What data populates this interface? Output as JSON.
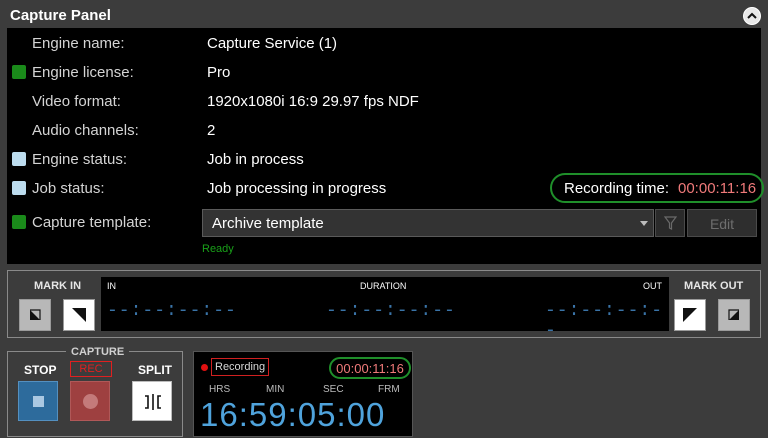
{
  "panel": {
    "title": "Capture Panel",
    "collapse_icon": "chevron-up-icon"
  },
  "info": {
    "engine_name": {
      "label": "Engine name:",
      "value": "Capture Service (1)"
    },
    "engine_license": {
      "label": "Engine license:",
      "value": "Pro",
      "status_color": "#1a8a1a"
    },
    "video_format": {
      "label": "Video format:",
      "value": "1920x1080i 16:9 29.97 fps NDF"
    },
    "audio_channels": {
      "label": "Audio channels:",
      "value": "2"
    },
    "engine_status": {
      "label": "Engine status:",
      "value": "Job in process",
      "status_color": "#bcdcee"
    },
    "job_status": {
      "label": "Job status:",
      "value": "Job processing in progress",
      "status_color": "#bcdcee"
    },
    "recording_time": {
      "label": "Recording time:",
      "value": "00:00:11:16"
    },
    "capture_template": {
      "label": "Capture template:",
      "value": "Archive template",
      "status_color": "#1a8a1a"
    },
    "filter_icon": "filter-icon",
    "edit_label": "Edit",
    "status_text": "Ready"
  },
  "timecode": {
    "mark_in_label": "MARK IN",
    "mark_out_label": "MARK OUT",
    "in_label": "IN",
    "duration_label": "DURATION",
    "out_label": "OUT",
    "in_value": "--:--:--:--",
    "duration_value": "--:--:--:--",
    "out_value": "--:--:--:--"
  },
  "capture": {
    "title": "CAPTURE",
    "stop_label": "STOP",
    "rec_label": "REC",
    "split_label": "SPLIT"
  },
  "recorder": {
    "recording_tag": "Recording",
    "elapsed": "00:00:11:16",
    "units": {
      "hrs": "HRS",
      "min": "MIN",
      "sec": "SEC",
      "frm": "FRM"
    },
    "clock": "16:59:05:00"
  }
}
